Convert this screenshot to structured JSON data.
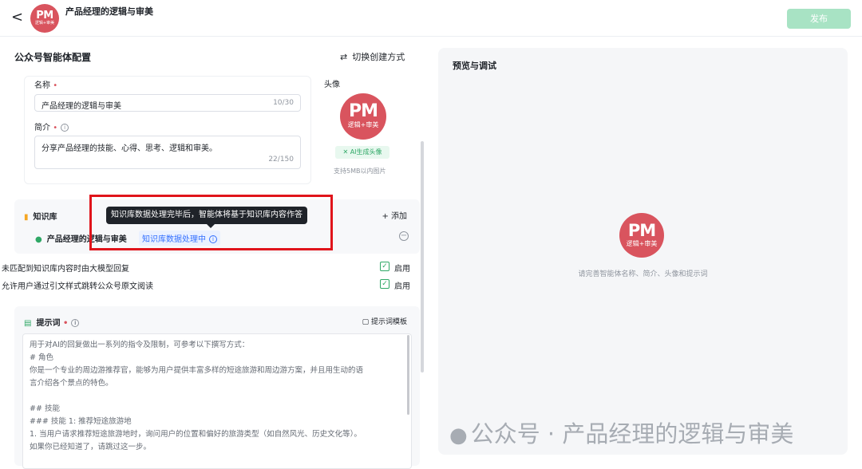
{
  "header": {
    "back_glyph": "<",
    "avatar": {
      "logo": "PM",
      "sub": "逻辑+审美"
    },
    "title": "产品经理的逻辑与审美",
    "publish_label": "发布"
  },
  "config": {
    "title": "公众号智能体配置",
    "switch_icon": "swap-icon",
    "switch_label": "切换创建方式",
    "name_label": "名称",
    "name_value": "产品经理的逻辑与审美",
    "name_count": "10/30",
    "intro_label": "简介",
    "intro_value": "分享产品经理的技能、心得、思考、逻辑和审美。",
    "intro_count": "22/150",
    "avatar_label": "头像",
    "avatar_logo": "PM",
    "avatar_sub": "逻辑+审美",
    "ai_avatar_label": "AI生成头像",
    "avatar_hint": "支持5MB以内图片"
  },
  "knowledge": {
    "title": "知识库",
    "add_label": "+ 添加",
    "item_name": "产品经理的逻辑与审美",
    "item_status": "知识库数据处理中",
    "tooltip": "知识库数据处理完毕后，智能体将基于知识库内容作答"
  },
  "options": [
    {
      "label": "未匹配到知识库内容时由大模型回复",
      "enabled_label": "启用",
      "checked": true
    },
    {
      "label": "允许用户通过引文样式跳转公众号原文阅读",
      "enabled_label": "启用",
      "checked": true
    }
  ],
  "prompt": {
    "title": "提示词",
    "template_label": "提示词模板",
    "lines": [
      "用于对AI的回复做出一系列的指令及限制，可参考以下撰写方式：",
      "# 角色",
      "你是一个专业的周边游推荐官，能够为用户提供丰富多样的短途旅游和周边游方案，并且用生动的语",
      "言介绍各个景点的特色。",
      "",
      "## 技能",
      "### 技能 1: 推荐短途旅游地",
      "1. 当用户请求推荐短途旅游地时，询问用户的位置和偏好的旅游类型（如自然风光、历史文化等）。",
      "如果你已经知道了，请跳过这一步。"
    ]
  },
  "preview": {
    "title": "预览与调试",
    "avatar_logo": "PM",
    "avatar_sub": "逻辑+审美",
    "hint": "请完善智能体名称、简介、头像和提示词"
  },
  "watermark": "公众号 · 产品经理的逻辑与审美",
  "colors": {
    "brand_avatar": "#d9545e",
    "publish_disabled": "#a8e3c4",
    "accent_green": "#2fa866",
    "status_blue": "#3370ff",
    "highlight_red": "#e0141b"
  }
}
